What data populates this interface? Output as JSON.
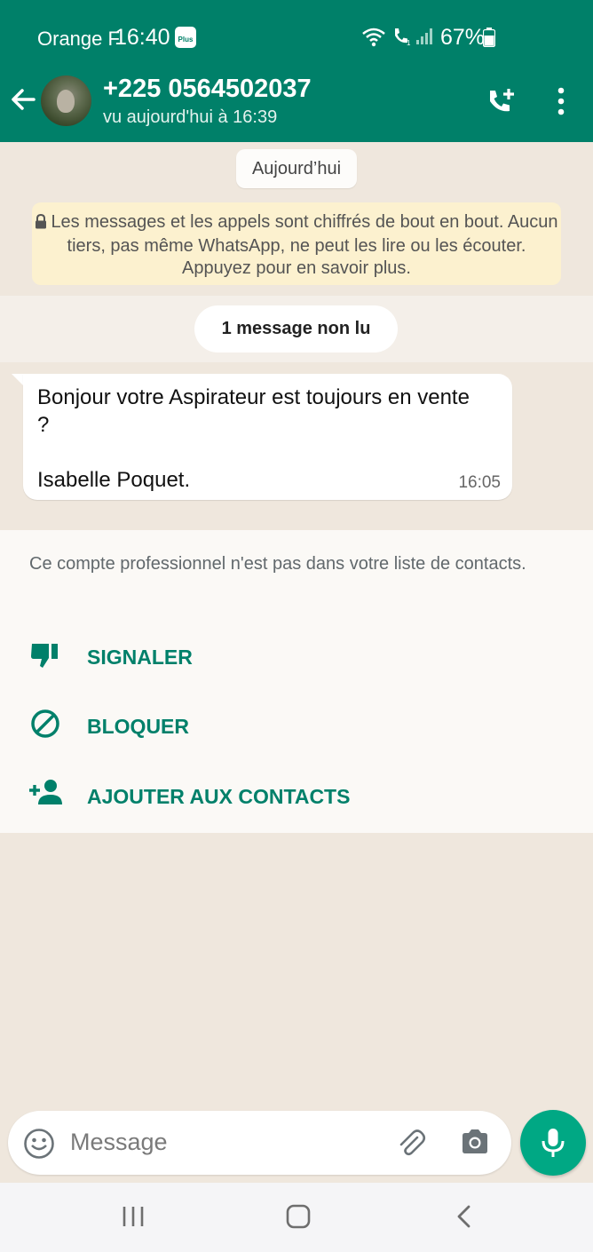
{
  "status_bar": {
    "carrier": "Orange F",
    "time": "16:40",
    "badge_text": "Plus",
    "battery": "67%"
  },
  "header": {
    "contact_name": "+225 0564502037",
    "last_seen": "vu aujourd'hui à 16:39",
    "icons": [
      "back-arrow-icon",
      "add-call-icon",
      "more-vertical-icon"
    ]
  },
  "chat": {
    "date_chip": "Aujourd’hui",
    "encryption_notice": "Les messages et les appels sont chiffrés de bout en bout. Aucun tiers, pas même WhatsApp, ne peut les lire ou les écouter. Appuyez pour en savoir plus.",
    "unread_chip": "1 message non lu",
    "messages": [
      {
        "text": "Bonjour votre Aspirateur est  toujours en vente ?\n\nIsabelle Poquet.",
        "time": "16:05"
      }
    ]
  },
  "business_panel": {
    "note": "Ce compte professionnel n'est pas dans votre liste de contacts.",
    "actions": [
      {
        "label": "SIGNALER",
        "icon": "thumbs-down-icon"
      },
      {
        "label": "BLOQUER",
        "icon": "block-icon"
      },
      {
        "label": "AJOUTER AUX CONTACTS",
        "icon": "add-person-icon"
      }
    ]
  },
  "composer": {
    "placeholder": "Message"
  },
  "colors": {
    "header": "#008069",
    "accent": "#00a884",
    "chat_background": "#efe7dd",
    "action_text": "#00806a"
  }
}
